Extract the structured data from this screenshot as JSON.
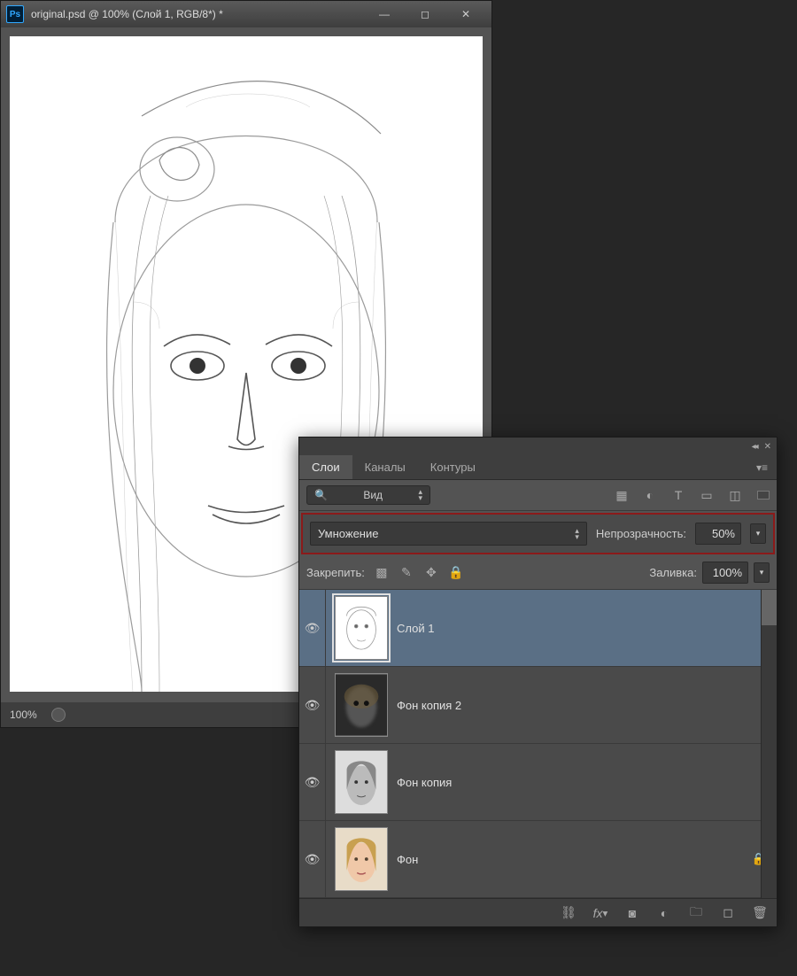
{
  "doc": {
    "app_icon": "Ps",
    "title": "original.psd @ 100% (Слой 1, RGB/8*) *",
    "zoom": "100%"
  },
  "panel": {
    "tabs": [
      "Слои",
      "Каналы",
      "Контуры"
    ],
    "active_tab": 0,
    "search_label": "Вид",
    "blend_mode": "Умножение",
    "opacity_label": "Непрозрачность:",
    "opacity_value": "50%",
    "lock_label": "Закрепить:",
    "fill_label": "Заливка:",
    "fill_value": "100%",
    "layers": [
      {
        "name": "Слой 1",
        "selected": true,
        "visible": true,
        "thumb": "sketch",
        "locked": false
      },
      {
        "name": "Фон копия 2",
        "selected": false,
        "visible": true,
        "thumb": "blur",
        "locked": false
      },
      {
        "name": "Фон копия",
        "selected": false,
        "visible": true,
        "thumb": "gray",
        "locked": false
      },
      {
        "name": "Фон",
        "selected": false,
        "visible": true,
        "thumb": "color",
        "locked": true
      }
    ]
  }
}
